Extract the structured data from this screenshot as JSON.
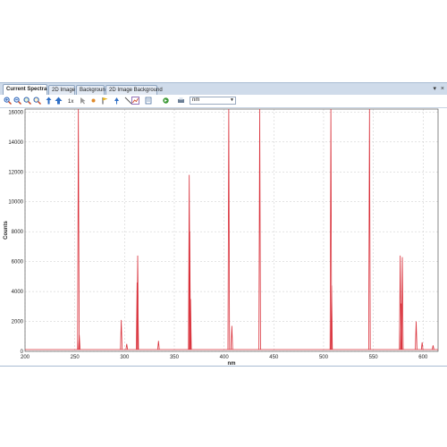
{
  "tabs": [
    {
      "label": "Current Spectra",
      "active": true
    },
    {
      "label": "2D Image",
      "active": false
    },
    {
      "label": "Background",
      "active": false
    },
    {
      "label": "2D Image Background",
      "active": false
    }
  ],
  "window_controls": {
    "dropdown": "▾",
    "pin": "×"
  },
  "toolbar": {
    "unit_select_value": "nm",
    "buttons": [
      "zoom-in-icon",
      "zoom-out-icon",
      "zoom-region-icon",
      "zoom-reset-icon",
      "pan-icon",
      "move-up-icon",
      "scale-icon",
      "cursor-icon",
      "marker-icon",
      "flag-icon",
      "peak-icon",
      "line-icon",
      "chart-type-icon",
      "layers-icon",
      "export-icon"
    ]
  },
  "colors": {
    "series": "#d9303a",
    "grid": "#c8c8c8",
    "frame": "#555555",
    "tab_bg": "#e2e9f3",
    "window_bg": "#cfdbea"
  },
  "chart_data": {
    "type": "line",
    "xlabel": "nm",
    "ylabel": "Counts",
    "xlim": [
      200,
      615
    ],
    "ylim": [
      0,
      16200
    ],
    "xticks": [
      200,
      250,
      300,
      350,
      400,
      450,
      500,
      550,
      600
    ],
    "yticks": [
      0,
      2000,
      4000,
      6000,
      8000,
      10000,
      12000,
      14000,
      16000
    ],
    "grid": true,
    "baseline": 120,
    "series": [
      {
        "peaks": [
          {
            "x": 253.6,
            "y": 16200
          },
          {
            "x": 254.5,
            "y": 1100
          },
          {
            "x": 296.7,
            "y": 2100
          },
          {
            "x": 302.2,
            "y": 500
          },
          {
            "x": 312.6,
            "y": 4600
          },
          {
            "x": 313.2,
            "y": 6400
          },
          {
            "x": 334.1,
            "y": 700
          },
          {
            "x": 365.0,
            "y": 11800
          },
          {
            "x": 365.5,
            "y": 8000
          },
          {
            "x": 366.3,
            "y": 3500
          },
          {
            "x": 404.7,
            "y": 16200
          },
          {
            "x": 407.8,
            "y": 1700
          },
          {
            "x": 435.8,
            "y": 16200
          },
          {
            "x": 546.1,
            "y": 16200
          },
          {
            "x": 507.3,
            "y": 16200
          },
          {
            "x": 508.0,
            "y": 4400
          },
          {
            "x": 577.0,
            "y": 6400
          },
          {
            "x": 579.1,
            "y": 6300
          },
          {
            "x": 578.0,
            "y": 3200
          },
          {
            "x": 593.0,
            "y": 2000
          },
          {
            "x": 599.0,
            "y": 600
          },
          {
            "x": 610.0,
            "y": 400
          }
        ]
      }
    ]
  }
}
